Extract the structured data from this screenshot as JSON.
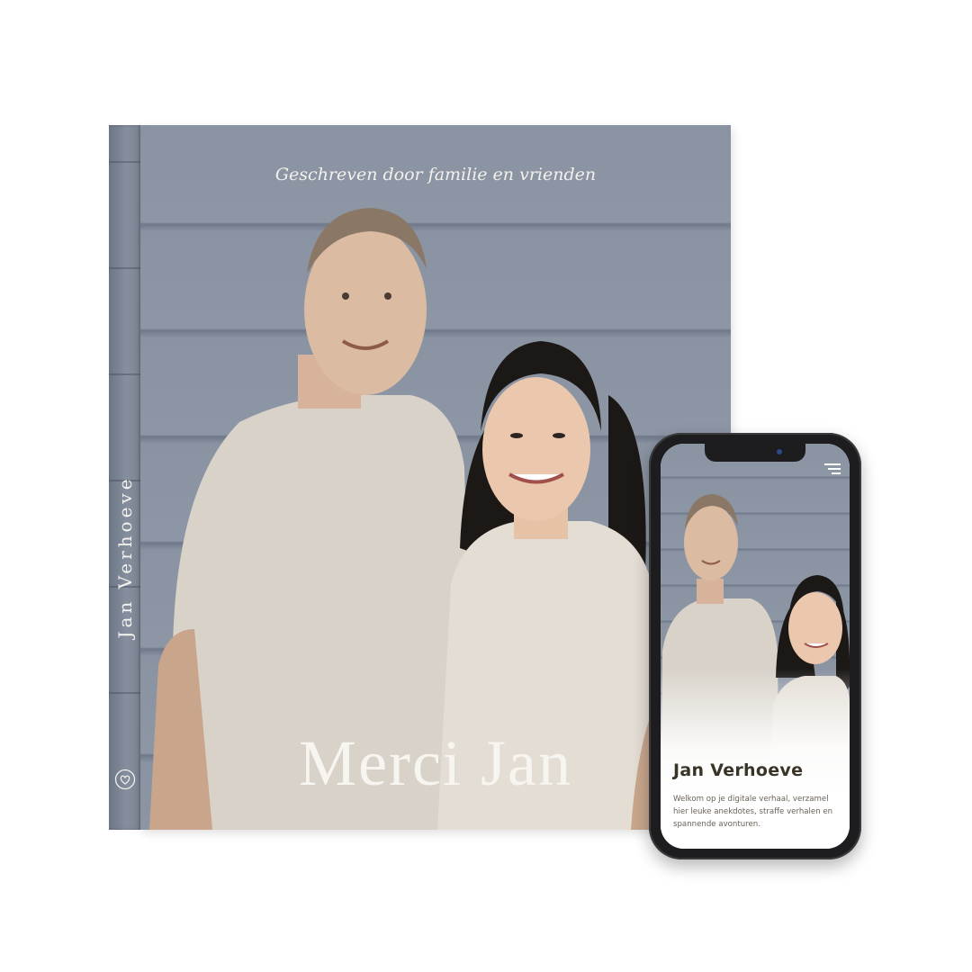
{
  "book": {
    "spine_title": "Jan Verhoeve",
    "spine_logo_icon": "heart-logo-icon",
    "cover_subtitle": "Geschreven door familie en vrienden",
    "cover_title": "Merci Jan"
  },
  "phone": {
    "menu_icon": "hamburger-menu-icon",
    "name": "Jan Verhoeve",
    "intro": "Welkom op je digitale verhaal, verzamel hier leuke anekdotes, straffe verhalen en spannende avonturen."
  },
  "colors": {
    "wall": "#8a93a2",
    "cover_text": "#f3f1ec",
    "name_text": "#3a3327",
    "phone_frame": "#1d1d1f"
  }
}
